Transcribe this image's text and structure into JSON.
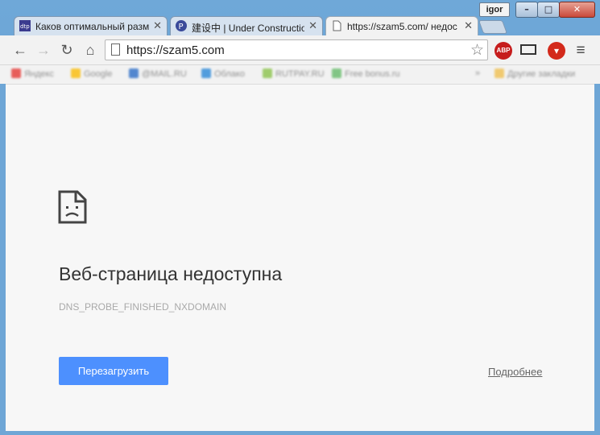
{
  "window": {
    "user": "igor",
    "controls": {
      "minimize": "–",
      "maximize": "□",
      "close": "✕"
    }
  },
  "tabs": [
    {
      "title": "Каков оптимальный разм",
      "favicon": "dtp-icon",
      "close": "✕"
    },
    {
      "title": "建设中 | Under Constructio",
      "favicon": "p-icon",
      "favicon_text": "P",
      "close": "✕"
    },
    {
      "title": "https://szam5.com/ недос",
      "favicon": "page-icon",
      "close": "✕"
    }
  ],
  "toolbar": {
    "back": "←",
    "forward": "→",
    "reload": "↻",
    "home": "⌂",
    "url": "https://szam5.com",
    "star": "☆",
    "abp": "ABP",
    "menu": "≡",
    "download": "▾"
  },
  "bookmarks": [
    {
      "label": "Яндекс",
      "color": "#e53935"
    },
    {
      "label": "Google",
      "color": "#fbbc05"
    },
    {
      "label": "@MAIL.RU",
      "color": "#2a6cc7"
    },
    {
      "label": "Облако",
      "color": "#2a88d8"
    },
    {
      "label": "RUTPAY.RU",
      "color": "#8bc34a"
    },
    {
      "label": "Free bonus.ru",
      "color": "#66bb6a"
    },
    {
      "label": "»",
      "color": ""
    },
    {
      "label": "Другие закладки",
      "color": "#f0c050"
    }
  ],
  "error": {
    "title": "Веб-страница недоступна",
    "code": "DNS_PROBE_FINISHED_NXDOMAIN",
    "reload_label": "Перезагрузить",
    "details_label": "Подробнее"
  },
  "colors": {
    "accent": "#4d90fe",
    "frame": "#6ea6d6"
  }
}
